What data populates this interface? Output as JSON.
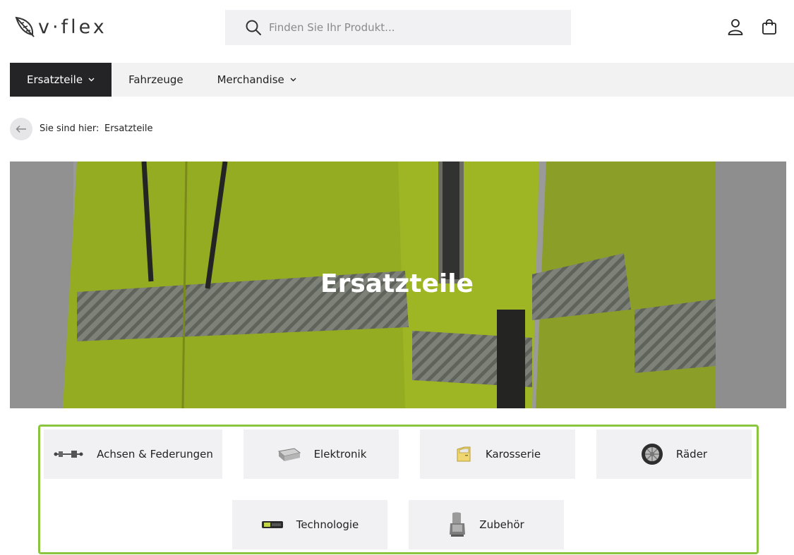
{
  "brand": {
    "name": "v·flex",
    "logo_icon": "leaf-logo-icon"
  },
  "search": {
    "placeholder": "Finden Sie Ihr Produkt..."
  },
  "header_icons": [
    "user-icon",
    "shopping-bag-icon"
  ],
  "nav": {
    "items": [
      {
        "label": "Ersatzteile",
        "has_dropdown": true,
        "active": true
      },
      {
        "label": "Fahrzeuge",
        "has_dropdown": false,
        "active": false
      },
      {
        "label": "Merchandise",
        "has_dropdown": true,
        "active": false
      }
    ]
  },
  "breadcrumb": {
    "label": "Sie sind hier:",
    "current": "Ersatzteile"
  },
  "hero": {
    "title": "Ersatzteile"
  },
  "categories": [
    {
      "label": "Achsen & Federungen",
      "icon": "axle-icon"
    },
    {
      "label": "Elektronik",
      "icon": "electronics-module-icon"
    },
    {
      "label": "Karosserie",
      "icon": "car-door-icon"
    },
    {
      "label": "Räder",
      "icon": "wheel-icon"
    },
    {
      "label": "Technologie",
      "icon": "display-device-icon"
    },
    {
      "label": "Zubehör",
      "icon": "child-seat-icon"
    }
  ],
  "colors": {
    "accent": "#8bc53f",
    "nav_active": "#242426",
    "nav_bg": "#f2f2f3"
  }
}
